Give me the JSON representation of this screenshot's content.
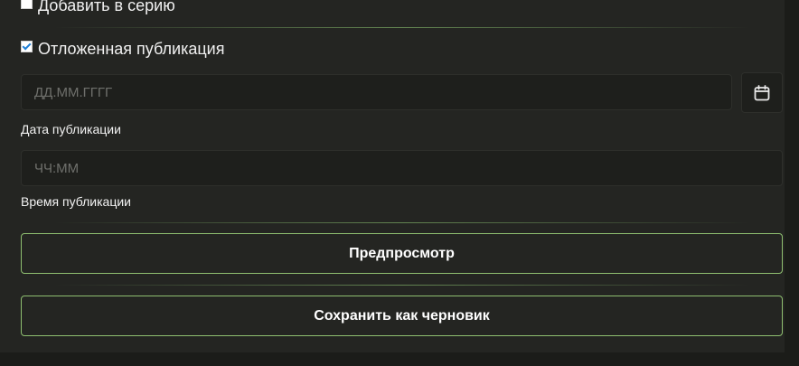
{
  "series_toggle": {
    "label": "Добавить в серию",
    "checked": false
  },
  "scheduled_toggle": {
    "label": "Отложенная публикация",
    "checked": true
  },
  "date_field": {
    "placeholder": "ДД.ММ.ГГГГ",
    "label": "Дата публикации"
  },
  "calendar_button": {
    "icon": "calendar-icon"
  },
  "time_field": {
    "placeholder": "ЧЧ:ММ",
    "label": "Время публикации"
  },
  "actions": {
    "preview_label": "Предпросмотр",
    "save_draft_label": "Сохранить как черновик"
  },
  "colors": {
    "background": "#1b1c19",
    "panel": "#242522",
    "accent_border": "#8fbf70",
    "input_bg": "#1e1f1c"
  }
}
